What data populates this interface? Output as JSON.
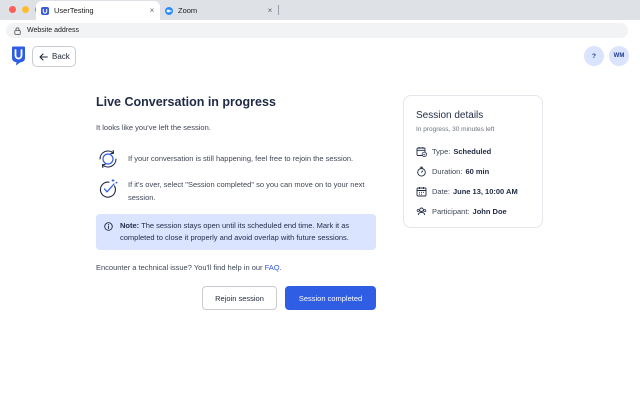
{
  "browser": {
    "tabs": [
      {
        "title": "UserTesting",
        "active": true
      },
      {
        "title": "Zoom",
        "active": false
      }
    ],
    "tab_close_glyph": "×",
    "address": "Website address"
  },
  "header": {
    "back_label": "Back",
    "help_label": "?",
    "avatar_initials": "WM"
  },
  "main": {
    "title": "Live Conversation in progress",
    "intro": "It looks like you've left the session.",
    "steps": [
      {
        "icon": "rejoin-icon",
        "text": "If your conversation is still happening, feel free to rejoin the session."
      },
      {
        "icon": "completed-check-icon",
        "text": "If it's over, select \"Session completed\" so you can move on to your next session."
      }
    ],
    "note": {
      "label": "Note:",
      "text": "The session stays open until its scheduled end time. Mark it as completed to close it properly and avoid overlap with future sessions."
    },
    "faq": {
      "prefix": "Encounter a technical issue? You'll find help in our ",
      "link": "FAQ",
      "suffix": "."
    },
    "buttons": {
      "rejoin": "Rejoin session",
      "complete": "Session completed"
    }
  },
  "details": {
    "title": "Session details",
    "subtitle": "In progress, 30 minutes left",
    "items": [
      {
        "icon": "calendar-check-icon",
        "label": "Type:",
        "value": "Scheduled"
      },
      {
        "icon": "stopwatch-icon",
        "label": "Duration:",
        "value": "60 min"
      },
      {
        "icon": "calendar-icon",
        "label": "Date:",
        "value": "June 13, 10:00 AM"
      },
      {
        "icon": "participant-icon",
        "label": "Participant:",
        "value": "John Doe"
      }
    ]
  },
  "colors": {
    "primary": "#2f5de3",
    "note_bg": "#dbe4fe",
    "title": "#1f2a44"
  }
}
